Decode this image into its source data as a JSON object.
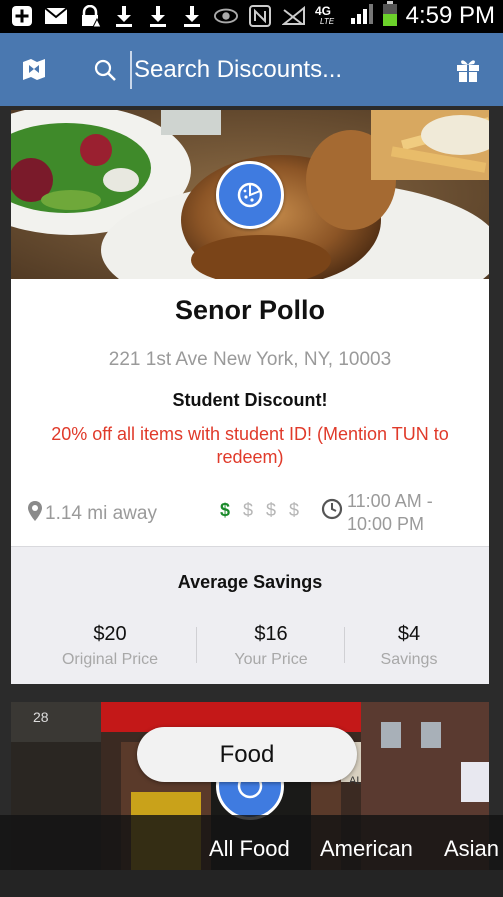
{
  "statusbar": {
    "time": "4:59 PM",
    "network": "4G LTE",
    "icons": [
      "add-icon",
      "mail-icon",
      "lock-warning-icon",
      "download-icon",
      "download-icon",
      "download-icon",
      "eye-icon",
      "nfc-icon",
      "no-signal-icon",
      "4g-lte-icon",
      "signal-bars-icon",
      "battery-icon"
    ]
  },
  "appbar": {
    "search_placeholder": "Search Discounts...",
    "colors": {
      "bar": "#4a78b0"
    }
  },
  "card": {
    "name": "Senor Pollo",
    "address": "221 1st Ave New York, NY, 10003",
    "discount_title": "Student Discount!",
    "discount_text": "20% off all items with student ID! (Mention TUN to redeem)",
    "distance": "1.14 mi away",
    "price_level": {
      "active": "$",
      "inactive": "$ $ $"
    },
    "hours_open": "11:00 AM -",
    "hours_close": "10:00 PM",
    "category_icon": "pizza-icon",
    "savings": {
      "title": "Average Savings",
      "original_value": "$20",
      "original_label": "Original Price",
      "your_value": "$16",
      "your_label": "Your Price",
      "savings_value": "$4",
      "savings_label": "Savings"
    },
    "colors": {
      "discount_text": "#e03a2a",
      "price_active": "#1a8a2a",
      "badge": "#3f7be0"
    }
  },
  "card2": {
    "storefront_number": "28",
    "sign_text": "ALES"
  },
  "filter_pill": "Food",
  "categories": [
    "All Food",
    "American",
    "Asian"
  ]
}
